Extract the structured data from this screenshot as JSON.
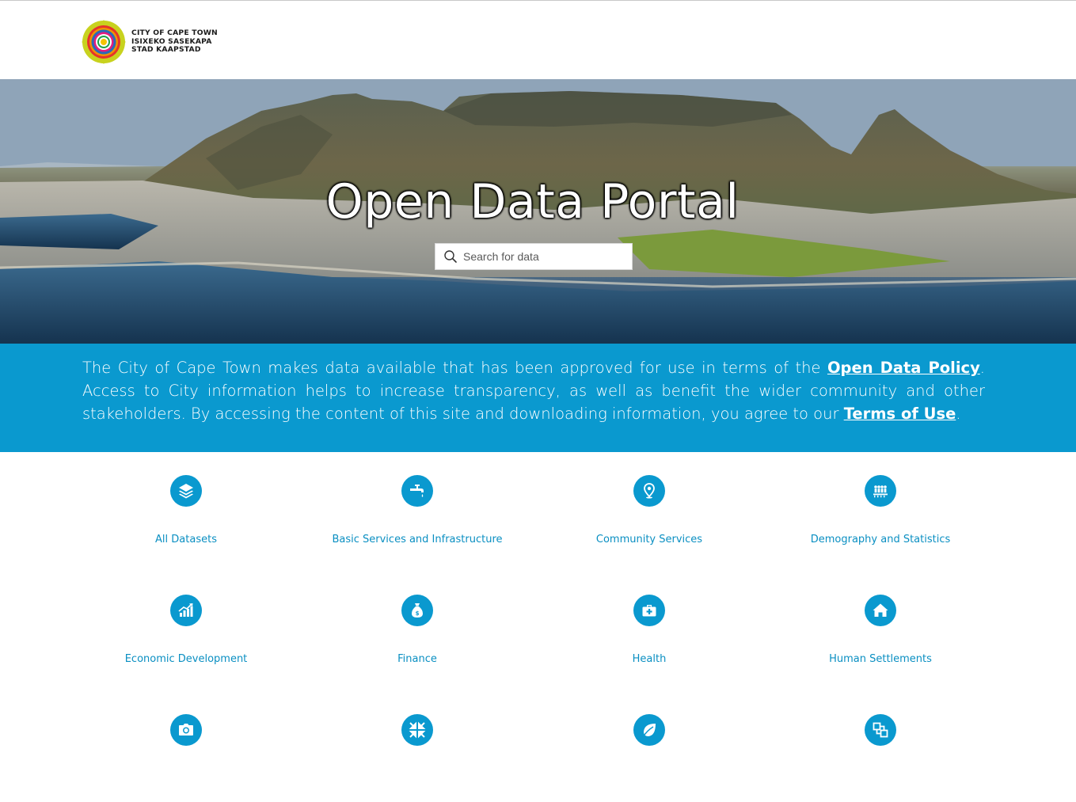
{
  "logo": {
    "lines": [
      "CITY OF CAPE TOWN",
      "ISIXEKO SASEKAPA",
      "STAD KAAPSTAD"
    ]
  },
  "hero": {
    "title": "Open Data Portal",
    "search_placeholder": "Search for data"
  },
  "banner": {
    "part1": "The City of Cape Town makes data available that has been approved for use in terms of the ",
    "link1": "Open Data Policy",
    "part2": ". Access to City information helps to increase transparency, as well as benefit the wider community and other stakeholders. By accessing the content of this site and downloading information, you agree to our ",
    "link2": "Terms of Use",
    "part3": "."
  },
  "categories": [
    {
      "label": "All Datasets",
      "icon": "layers-icon"
    },
    {
      "label": "Basic Services and Infrastructure",
      "icon": "water-tap-icon"
    },
    {
      "label": "Community Services",
      "icon": "map-pin-icon"
    },
    {
      "label": "Demography and Statistics",
      "icon": "people-icon"
    },
    {
      "label": "Economic Development",
      "icon": "growth-chart-icon"
    },
    {
      "label": "Finance",
      "icon": "money-bag-icon"
    },
    {
      "label": "Health",
      "icon": "first-aid-kit-icon"
    },
    {
      "label": "Human Settlements",
      "icon": "house-icon"
    },
    {
      "label": "",
      "icon": "camera-icon"
    },
    {
      "label": "",
      "icon": "arrows-collapse-icon"
    },
    {
      "label": "",
      "icon": "leaf-icon"
    },
    {
      "label": "",
      "icon": "connected-squares-icon"
    }
  ],
  "colors": {
    "accent": "#0a99cf",
    "link_text": "#0a8fc2"
  }
}
